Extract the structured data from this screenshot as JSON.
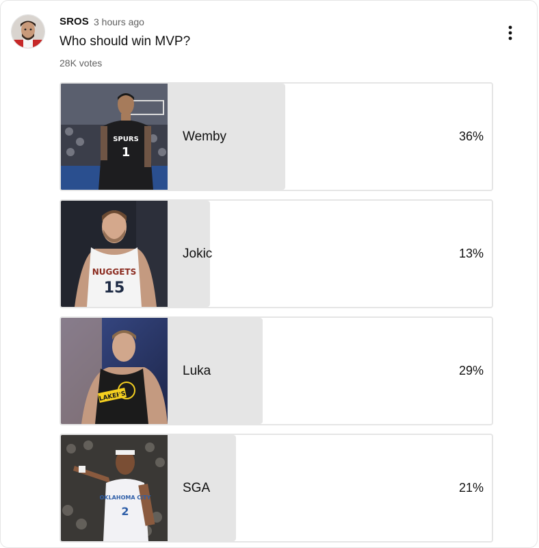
{
  "post": {
    "author": "SROS",
    "time": "3 hours ago",
    "question": "Who should win MVP?",
    "votes": "28K votes"
  },
  "colors": {
    "bar_fill": "#e5e5e5",
    "border": "#e5e5e5",
    "secondary_text": "#606060"
  },
  "icons": {
    "menu": "more-vert-icon"
  },
  "poll": {
    "options": [
      {
        "label": "Wemby",
        "percent": "36%",
        "value": 36,
        "jersey_text": "SPURS",
        "jersey_number": "1",
        "jersey_color": "#1d1d1f"
      },
      {
        "label": "Jokic",
        "percent": "13%",
        "value": 13,
        "jersey_text": "NUGGETS",
        "jersey_number": "15",
        "jersey_color": "#f4f4f4"
      },
      {
        "label": "Luka",
        "percent": "29%",
        "value": 29,
        "jersey_text": "LAKERS",
        "jersey_number": "",
        "jersey_color": "#1b1b1b"
      },
      {
        "label": "SGA",
        "percent": "21%",
        "value": 21,
        "jersey_text": "OKLAHOMA CITY",
        "jersey_number": "2",
        "jersey_color": "#f2f2f5"
      }
    ]
  }
}
